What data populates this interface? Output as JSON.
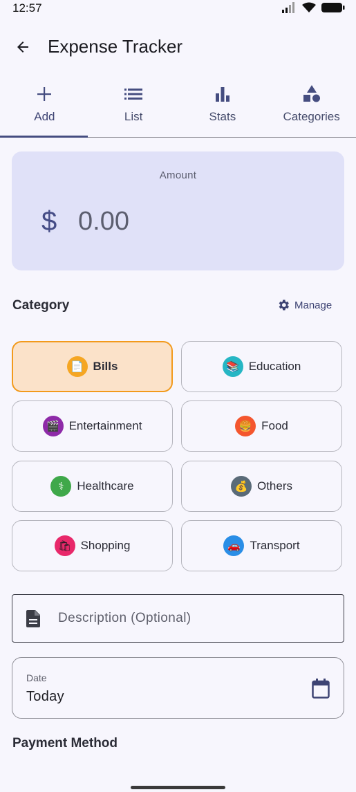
{
  "status": {
    "time": "12:57"
  },
  "app_bar": {
    "title": "Expense Tracker"
  },
  "tabs": [
    {
      "label": "Add",
      "icon": "plus-icon",
      "active": true
    },
    {
      "label": "List",
      "icon": "list-icon",
      "active": false
    },
    {
      "label": "Stats",
      "icon": "bar-chart-icon",
      "active": false
    },
    {
      "label": "Categories",
      "icon": "shapes-icon",
      "active": false
    }
  ],
  "amount": {
    "label": "Amount",
    "currency": "$",
    "value": "0.00"
  },
  "category": {
    "title": "Category",
    "manage_label": "Manage",
    "items": [
      {
        "label": "Bills",
        "emoji": "📄",
        "color": "#f5a623",
        "selected": true
      },
      {
        "label": "Education",
        "emoji": "📚",
        "color": "#26b6c4",
        "selected": false
      },
      {
        "label": "Entertainment",
        "emoji": "🎬",
        "color": "#8e2aa8",
        "selected": false
      },
      {
        "label": "Food",
        "emoji": "🍔",
        "color": "#f4562e",
        "selected": false
      },
      {
        "label": "Healthcare",
        "emoji": "⚕",
        "color": "#3fa84a",
        "selected": false
      },
      {
        "label": "Others",
        "emoji": "💰",
        "color": "#5a6b78",
        "selected": false
      },
      {
        "label": "Shopping",
        "emoji": "🛍",
        "color": "#e8286a",
        "selected": false
      },
      {
        "label": "Transport",
        "emoji": "🚗",
        "color": "#2a8ee6",
        "selected": false
      }
    ]
  },
  "description": {
    "placeholder": "Description (Optional)"
  },
  "date": {
    "label": "Date",
    "value": "Today"
  },
  "payment": {
    "title": "Payment Method"
  },
  "colors": {
    "accent": "#454d80",
    "selected_border": "#f29a1c",
    "selected_bg": "#fbe2c9",
    "amount_card": "#e0e1f8"
  }
}
